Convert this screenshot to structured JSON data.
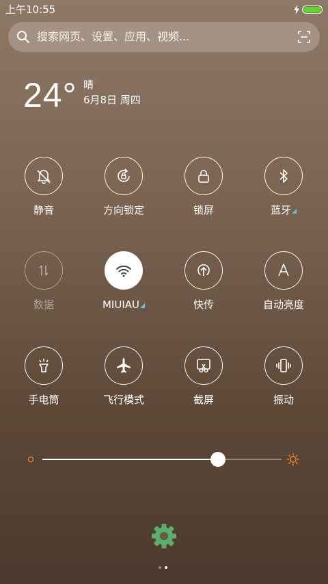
{
  "status_bar": {
    "time": "上午10:55",
    "battery_level": 1.0,
    "battery_color": "#5bd62b"
  },
  "search": {
    "placeholder": "搜索网页、设置、应用、视频..."
  },
  "weather": {
    "temperature": "24°",
    "condition": "晴",
    "date": "6月8日 周四"
  },
  "toggles": [
    {
      "label": "静音",
      "icon": "bell-off-icon",
      "state": "off"
    },
    {
      "label": "方向锁定",
      "icon": "rotation-lock-icon",
      "state": "off"
    },
    {
      "label": "锁屏",
      "icon": "lock-icon",
      "state": "off"
    },
    {
      "label": "蓝牙",
      "icon": "bluetooth-icon",
      "state": "off",
      "has_more": true
    },
    {
      "label": "数据",
      "icon": "mobile-data-icon",
      "state": "disabled"
    },
    {
      "label": "MIUIAU",
      "icon": "wifi-icon",
      "state": "on",
      "has_more": true
    },
    {
      "label": "快传",
      "icon": "quick-transfer-icon",
      "state": "off"
    },
    {
      "label": "自动亮度",
      "icon": "auto-brightness-icon",
      "state": "off"
    },
    {
      "label": "手电筒",
      "icon": "flashlight-icon",
      "state": "off"
    },
    {
      "label": "飞行模式",
      "icon": "airplane-icon",
      "state": "off"
    },
    {
      "label": "截屏",
      "icon": "screenshot-icon",
      "state": "off"
    },
    {
      "label": "振动",
      "icon": "vibrate-icon",
      "state": "off"
    }
  ],
  "brightness": {
    "level": 0.734,
    "accent_color": "#e8812a"
  },
  "settings": {
    "icon": "gear-icon",
    "color": "#5cae6e"
  },
  "pager": {
    "total": 2,
    "current": 2
  }
}
